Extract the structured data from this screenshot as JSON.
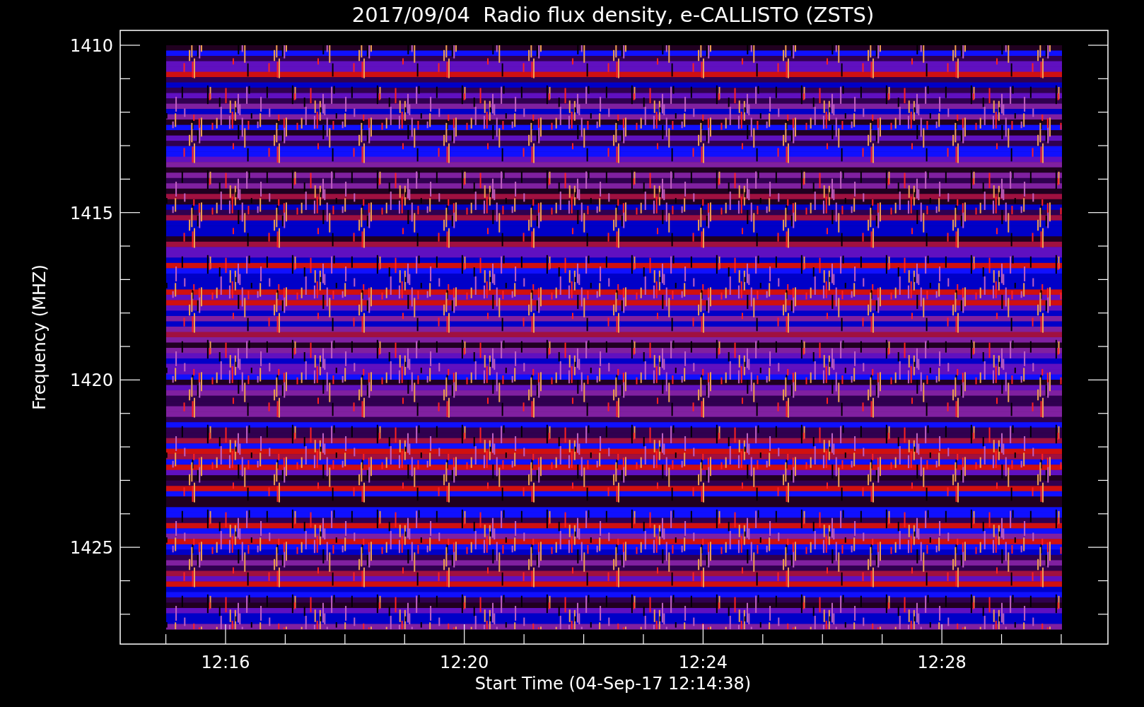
{
  "title": "2017/09/04  Radio flux density, e-CALLISTO (ZSTS)",
  "y_axis": {
    "label": "Frequency (MHZ)",
    "ticks": [
      "1410",
      "1415",
      "1420",
      "1425"
    ]
  },
  "x_axis": {
    "label": "Start Time (04-Sep-17 12:14:38)",
    "ticks": [
      "12:16",
      "12:20",
      "12:24",
      "12:28"
    ]
  }
}
